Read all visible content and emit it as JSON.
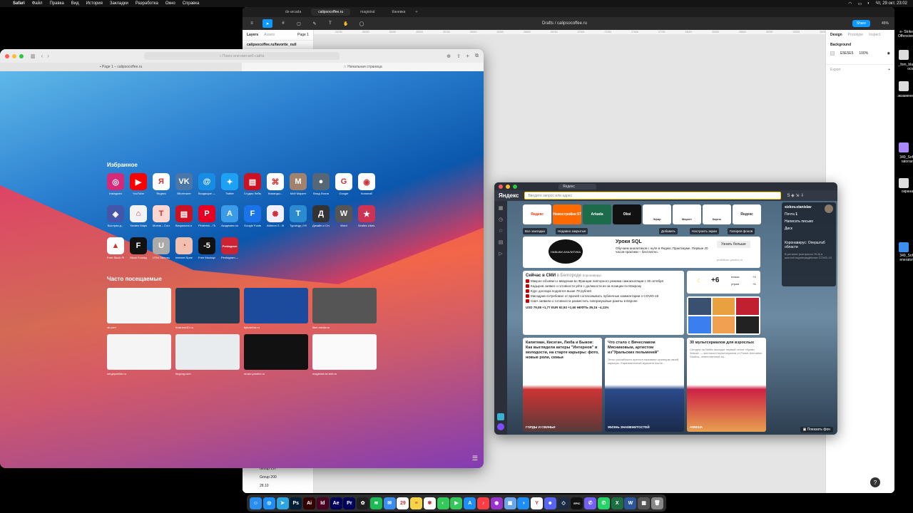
{
  "menubar": {
    "app": "Safari",
    "items": [
      "Файл",
      "Правка",
      "Вид",
      "История",
      "Закладки",
      "Разработка",
      "Окно",
      "Справка"
    ],
    "clock": "Чт, 29 окт.  23:02"
  },
  "desktop": {
    "files": [
      "e- Strike",
      "Offensive",
      "_fom_bla",
      "ocs",
      "экзамене",
      "349_Sof",
      "ratorrar",
      "окрана",
      "349_Sof",
      "enerator"
    ]
  },
  "figma": {
    "tabs": [
      "ds-arcada",
      "calipsocoffee.ru",
      "magistral",
      "Каневка"
    ],
    "active_tab": "calipsocoffee.ru",
    "breadcrumb_drafts": "Drafts",
    "breadcrumb_sep": "/",
    "doc_title": "calipsocoffee.ru",
    "share_label": "Share",
    "zoom": "45%",
    "left_tabs": [
      "Layers",
      "Assets",
      "Page 1"
    ],
    "layers": [
      "calipsocoffee.ru/favorite_null"
    ],
    "layers_bottom": [
      "Group 197",
      "Group 200",
      "28.10"
    ],
    "ruler_ticks": [
      "24750",
      "25000",
      "25250",
      "25500",
      "25750",
      "26000",
      "26250",
      "26500",
      "26750",
      "27000",
      "27250",
      "27500",
      "27750",
      "28000",
      "28250",
      "28500",
      "28750",
      "29000",
      "29250",
      "29500"
    ],
    "right_tabs": [
      "Design",
      "Prototype",
      "Inspect"
    ],
    "background_label": "Background",
    "bg_hex": "E5E5E5",
    "bg_opacity": "100%",
    "export_label": "Export",
    "help": "?"
  },
  "safari": {
    "address_placeholder": "Поиск или имя веб-сайта",
    "tabs": [
      "Page 1 – calipsocoffee.ru",
      "Начальная страница"
    ],
    "favorites_title": "Избранное",
    "favorites": [
      {
        "label": "Instagram",
        "icon": "instagram-icon",
        "glyph": "◎",
        "color": "#d6297a"
      },
      {
        "label": "YouTube",
        "icon": "youtube-icon",
        "glyph": "▶",
        "color": "#ff0000"
      },
      {
        "label": "Яндекс",
        "icon": "yandex-icon",
        "glyph": "Я",
        "color": "#ffffff"
      },
      {
        "label": "ВКонтакте",
        "icon": "vk-icon",
        "glyph": "VK",
        "color": "#4a76a8"
      },
      {
        "label": "Входящие — Почта...",
        "icon": "mail-icon",
        "glyph": "@",
        "color": "#168de2"
      },
      {
        "label": "Twitter",
        "icon": "twitter-icon",
        "glyph": "✦",
        "color": "#1da1f2"
      },
      {
        "label": "Студия Лебедева",
        "icon": "studio-icon",
        "glyph": "▤",
        "color": "#cc1122"
      },
      {
        "label": "Команды...",
        "icon": "command-icon",
        "glyph": "⌘",
        "color": "#ffffff"
      },
      {
        "label": "Мой Маркет",
        "icon": "market-icon",
        "glyph": "M",
        "color": "#a0826d"
      },
      {
        "label": "Влад Ляхов",
        "icon": "avatar-icon",
        "glyph": "●",
        "color": "#556677"
      },
      {
        "label": "Google",
        "icon": "google-icon",
        "glyph": "G",
        "color": "#ffffff"
      },
      {
        "label": "Кинопаб",
        "icon": "kinopub-icon",
        "glyph": "◉",
        "color": "#ffffff"
      }
    ],
    "favorites_row2": [
      {
        "label": "Быстрая д...",
        "icon": "speed-icon",
        "glyph": "◈",
        "color": "#4455aa"
      },
      {
        "label": "Yandex Maps",
        "icon": "maps-icon",
        "glyph": "⌂",
        "color": "#f3f3f3"
      },
      {
        "label": "Мотив – Сложна...",
        "icon": "motiv-icon",
        "glyph": "T",
        "color": "#ffd7d0"
      },
      {
        "label": "Визуальна я коммун...",
        "icon": "visual-icon",
        "glyph": "▤",
        "color": "#cc1122"
      },
      {
        "label": "Pinterest – Пинтерест",
        "icon": "pinterest-icon",
        "glyph": "P",
        "color": "#e60023"
      },
      {
        "label": "Академия нов обр...",
        "icon": "academy-icon",
        "glyph": "A",
        "color": "#3a9be8"
      },
      {
        "label": "Google Fonts",
        "icon": "fonts-icon",
        "glyph": "F",
        "color": "#1a73e8"
      },
      {
        "label": "Abbeon S - MA — HSL",
        "icon": "hsl-icon",
        "glyph": "✺",
        "color": "#f0f0ff"
      },
      {
        "label": "Typology | HSL",
        "icon": "typology-icon",
        "glyph": "T",
        "color": "#2a8bd0"
      },
      {
        "label": "Дизайн и Стилист...",
        "icon": "design-icon",
        "glyph": "Д",
        "color": "#333333"
      },
      {
        "label": "Word",
        "icon": "word-icon",
        "glyph": "W",
        "color": "#555555"
      },
      {
        "label": "Grafixx Likes.pl",
        "icon": "star-icon",
        "glyph": "★",
        "color": "#cc3355"
      }
    ],
    "favorites_row3": [
      {
        "label": "Free Stock Photos &...",
        "icon": "photos-icon",
        "glyph": "▲",
        "color": "#ffffff"
      },
      {
        "label": "Stock Footage...",
        "icon": "footage-icon",
        "glyph": "F",
        "color": "#111111"
      },
      {
        "label": "UTM Пилоты...",
        "icon": "utm-icon",
        "glyph": "U",
        "color": "#aaaaaa"
      },
      {
        "label": "Internet Speed Te...",
        "icon": "speedtest-icon",
        "glyph": "◔",
        "color": "#f0c0b0"
      },
      {
        "label": "Free Mockups...",
        "icon": "mockups-icon",
        "glyph": "-5",
        "color": "#111111"
      },
      {
        "label": "Pentagram — The wo...",
        "icon": "pentagram-icon",
        "glyph": "Pentagram",
        "color": "#cc2233"
      }
    ],
    "frequent_title": "Часто посещаемые",
    "frequent": [
      {
        "label": "vk.com",
        "bg": "#f5f5f5"
      },
      {
        "label": "business31.ru",
        "bg": "#2a3a50"
      },
      {
        "label": "flyhotelna.ru",
        "bg": "#1c4a9c"
      },
      {
        "label": "ilton-media.ru",
        "bg": "#555555"
      },
      {
        "label": "sergeychikin.ru",
        "bg": "#f5f5f5"
      },
      {
        "label": "tinypng.com",
        "bg": "#e8ecef"
      },
      {
        "label": "music.yandex.ru",
        "bg": "#111111"
      },
      {
        "label": "magistral.tel-birb.ru",
        "bg": "#fafafa"
      }
    ]
  },
  "yandex": {
    "tab_title": "Яндекс",
    "logo": "Яндекс",
    "search_placeholder": "Введите запрос или адрес",
    "tiles": [
      {
        "label": "Яндекс",
        "bg": "#ffffff",
        "fg": "#e31",
        "sub": ""
      },
      {
        "label": "Новостройки 67",
        "bg": "#ff6a00",
        "fg": "#fff",
        "sub": ""
      },
      {
        "label": "Arkada",
        "bg": "#1c6b4a",
        "fg": "#fff",
        "sub": ""
      },
      {
        "label": "Oksi",
        "bg": "#111111",
        "fg": "#fff",
        "sub": ""
      },
      {
        "label": "Эфир",
        "bg": "#ffffff",
        "fg": "#6b3ccc",
        "sub": "Эфир"
      },
      {
        "label": "Маркет",
        "bg": "#ffffff",
        "fg": "#fc0",
        "sub": "Маркет"
      },
      {
        "label": "Карты",
        "bg": "#ffffff",
        "fg": "#e31",
        "sub": "Карты"
      },
      {
        "label": "Яндекс",
        "bg": "#ffffff",
        "fg": "#333",
        "sub": ""
      }
    ],
    "buttons": [
      "Все закладки",
      "Недавно закрытые"
    ],
    "right_buttons": [
      "Добавить",
      "Настроить экран",
      "Галерея фонов"
    ],
    "ad": {
      "badge": "НАВЫКИ АНАЛИТИКА",
      "title": "Уроки SQL",
      "text": "Обучаем аналитиков с нуля в Яндекс.Практикуме. Первые 20 часов практики – бесплатно.",
      "cta": "Узнать больше",
      "domain": "praktikum.yandex.ru"
    },
    "news": {
      "title": "Сейчас в СМИ",
      "region": "в Белгороде",
      "tag": "Коронавирус",
      "items": [
        "Макрон объявил о введении во Франции повторного режима самоизоляции с 30 октября",
        "Кадыров заявил о готовности уйти с должности из-за позиции по Макрону",
        "Курс доллара поднялся выше 79 рублей",
        "Минздрав потребовал от врачей согласовывать публичные комментарии о COVID-19",
        "США заявили о готовности разместить гиперзвуковые ракеты в Европе"
      ],
      "rates": "USD 79,08 +1,77   EUR 92,93 +1,60   НЕФТЬ 39,15 –4,11%"
    },
    "weather": {
      "temp": "+6",
      "night_label": "ночью",
      "night": "+3",
      "morning_label": "утром",
      "morning": "+4"
    },
    "user": {
      "name": "sizkov.stanislav",
      "mail": "Почта",
      "mail_count": "1",
      "write": "Написать письмо",
      "disk": "Диск",
      "covid_title": "Коронавирус: Оперштаб области",
      "covid_text": "В регионе (контраста 76-й) в шестой подтверждённые COVID-19"
    },
    "cards": [
      {
        "title": "Капитман, Кисегач, Люба и Быков: Как выглядели актеры \"Интернов\" в молодости, на старте карьеры: фото, новые роли, семьи",
        "text": "",
        "caption": "ГОРДЫ И СВИНЬИ"
      },
      {
        "title": "Что стало с Вячеславом Мясниковым, артистом из\"Уральских пельменей\"",
        "text": "Этого российского артиста называют кузнецом своей карьеры. Харизматичный мужчина после...",
        "caption": "ЖИЗНЬ ЗНАМЕНИТОСТЕЙ"
      },
      {
        "title": "30 мультсериалов для взрослых",
        "text": "Сегодня на Netflix выходит первый сезон «Крови Зевса» — жестокого мультсериала от Power Animation Studios, ответственной за...",
        "caption": "АФИША"
      }
    ],
    "show_bg": "Показать фон"
  },
  "dock": {
    "apps": [
      {
        "name": "finder-icon",
        "glyph": "☺",
        "color": "#2a8ef0"
      },
      {
        "name": "safari-icon",
        "glyph": "◎",
        "color": "#1c8ef5"
      },
      {
        "name": "telegram-icon",
        "glyph": "➤",
        "color": "#2ca5e0"
      },
      {
        "name": "photoshop-icon",
        "glyph": "Ps",
        "color": "#001e36"
      },
      {
        "name": "illustrator-icon",
        "glyph": "Ai",
        "color": "#330000"
      },
      {
        "name": "indesign-icon",
        "glyph": "Id",
        "color": "#49021f"
      },
      {
        "name": "aftereffects-icon",
        "glyph": "Ae",
        "color": "#00005b"
      },
      {
        "name": "premiere-icon",
        "glyph": "Pr",
        "color": "#00005b"
      },
      {
        "name": "figma-icon",
        "glyph": "✿",
        "color": "#1e1e1e"
      },
      {
        "name": "spotify-icon",
        "glyph": "≋",
        "color": "#1db954"
      },
      {
        "name": "mail-app-icon",
        "glyph": "✉",
        "color": "#3b8ef0"
      },
      {
        "name": "calendar-icon",
        "glyph": "29",
        "color": "#ffffff"
      },
      {
        "name": "notes-icon",
        "glyph": "≡",
        "color": "#f5d547"
      },
      {
        "name": "photos-app-icon",
        "glyph": "✾",
        "color": "#ffffff"
      },
      {
        "name": "messages-icon",
        "glyph": "◐",
        "color": "#34c759"
      },
      {
        "name": "facetime-icon",
        "glyph": "▶",
        "color": "#34c759"
      },
      {
        "name": "appstore-icon",
        "glyph": "A",
        "color": "#1c8ef5"
      },
      {
        "name": "music-icon",
        "glyph": "♪",
        "color": "#fc3c44"
      },
      {
        "name": "podcasts-icon",
        "glyph": "◉",
        "color": "#9933cc"
      },
      {
        "name": "preview-icon",
        "glyph": "▣",
        "color": "#6aa6e8"
      },
      {
        "name": "chat-icon",
        "glyph": "◑",
        "color": "#1c8ef5"
      },
      {
        "name": "yandex-browser-icon",
        "glyph": "Y",
        "color": "#ffffff"
      },
      {
        "name": "discord-icon",
        "glyph": "☻",
        "color": "#5865f2"
      },
      {
        "name": "vpn-icon",
        "glyph": "◇",
        "color": "#1c2a44"
      },
      {
        "name": "epic-icon",
        "glyph": "EPIC",
        "color": "#111111"
      },
      {
        "name": "viber-icon",
        "glyph": "✆",
        "color": "#7360f2"
      },
      {
        "name": "whatsapp-icon",
        "glyph": "✆",
        "color": "#25d366"
      },
      {
        "name": "excel-icon",
        "glyph": "X",
        "color": "#1d6f42"
      },
      {
        "name": "word-app-icon",
        "glyph": "W",
        "color": "#2b579a"
      },
      {
        "name": "screenshot-icon",
        "glyph": "▦",
        "color": "#555555"
      },
      {
        "name": "trash-icon",
        "glyph": "🗑",
        "color": "#888888"
      }
    ]
  }
}
